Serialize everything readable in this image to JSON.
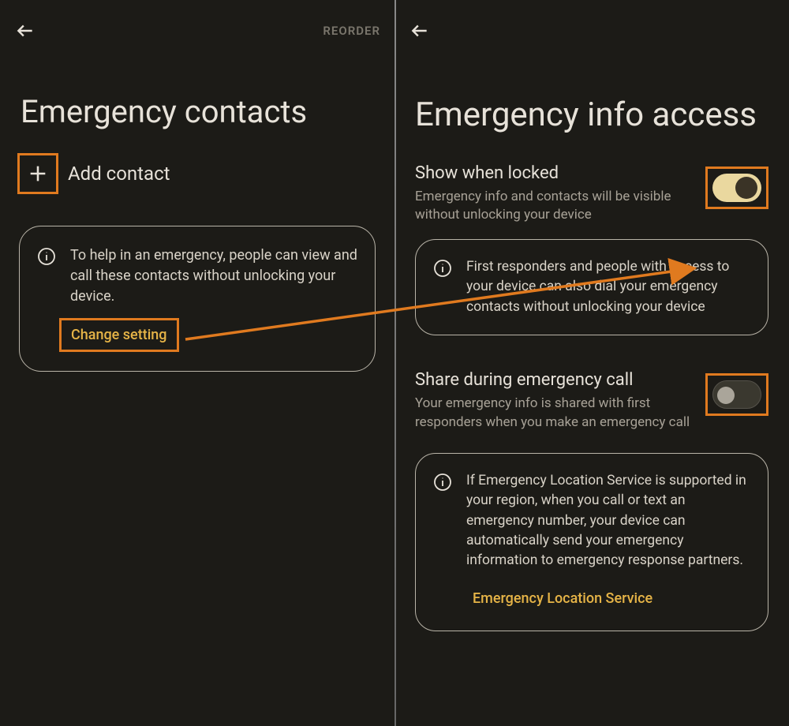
{
  "left": {
    "reorder_label": "REORDER",
    "title": "Emergency contacts",
    "add_contact_label": "Add contact",
    "info_text": "To help in an emergency, people can view and call these contacts without unlocking your device.",
    "change_setting_label": "Change setting"
  },
  "right": {
    "title": "Emergency info access",
    "show_locked": {
      "title": "Show when locked",
      "desc": "Emergency info and contacts will be visible without unlocking your device",
      "on": true
    },
    "responders_text": "First responders and people with access to your device can also dial your emergency contacts without unlocking your device",
    "share_call": {
      "title": "Share during emergency call",
      "desc": "Your emergency info is shared with first responders when you make an emergency call",
      "on": false
    },
    "els_text": "If Emergency Location Service is supported in your region, when you call or text an emergency number, your device can automatically send your emergency information to emergency response partners.",
    "els_link": "Emergency Location Service"
  },
  "colors": {
    "highlight": "#e07a1f",
    "accent_link": "#e6b447"
  }
}
